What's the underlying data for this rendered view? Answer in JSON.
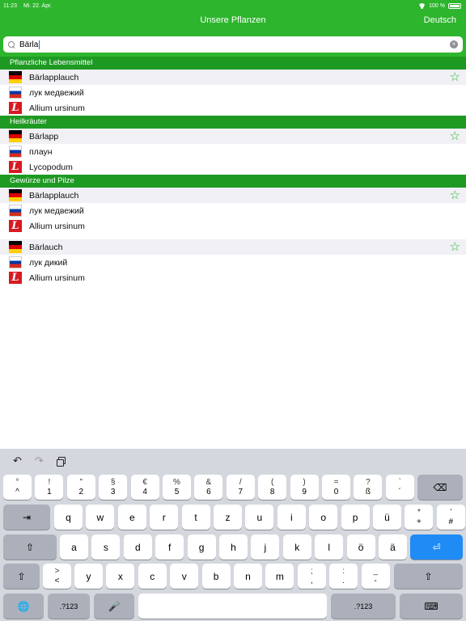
{
  "status": {
    "time": "11:23",
    "date": "Mi. 22. Apr.",
    "battery": "100 %"
  },
  "nav": {
    "title": "Unsere Pflanzen",
    "language_button": "Deutsch"
  },
  "search": {
    "value": "Bärla"
  },
  "sections": [
    {
      "header": "Pflanzliche Lebensmittel",
      "entries": [
        {
          "de": "Bärlapplauch",
          "ru": "лук медвежий",
          "la": "Allium ursinum"
        }
      ]
    },
    {
      "header": "Heilkräuter",
      "entries": [
        {
          "de": "Bärlapp",
          "ru": "плаун",
          "la": "Lycopodum"
        }
      ]
    },
    {
      "header": "Gewürze und Pilze",
      "entries": [
        {
          "de": "Bärlapplauch",
          "ru": "лук медвежий",
          "la": "Allium ursinum"
        },
        {
          "de": "Bärlauch",
          "ru": "лук дикий",
          "la": "Allium ursinum"
        }
      ]
    }
  ],
  "keyboard": {
    "toolbar": {
      "undo": "↶",
      "redo": "↷"
    },
    "row1": [
      {
        "top": "°",
        "bottom": "^"
      },
      {
        "top": "!",
        "bottom": "1"
      },
      {
        "top": "\"",
        "bottom": "2"
      },
      {
        "top": "§",
        "bottom": "3"
      },
      {
        "top": "€",
        "bottom": "4"
      },
      {
        "top": "%",
        "bottom": "5"
      },
      {
        "top": "&",
        "bottom": "6"
      },
      {
        "top": "/",
        "bottom": "7"
      },
      {
        "top": "(",
        "bottom": "8"
      },
      {
        "top": ")",
        "bottom": "9"
      },
      {
        "top": "=",
        "bottom": "0"
      },
      {
        "top": "?",
        "bottom": "ß"
      },
      {
        "top": "`",
        "bottom": "´"
      }
    ],
    "row2": [
      "q",
      "w",
      "e",
      "r",
      "t",
      "z",
      "u",
      "i",
      "o",
      "p",
      "ü"
    ],
    "row2_extra": [
      {
        "top": "*",
        "bottom": "+"
      },
      {
        "top": "'",
        "bottom": "#"
      }
    ],
    "row3": [
      "a",
      "s",
      "d",
      "f",
      "g",
      "h",
      "j",
      "k",
      "l",
      "ö",
      "ä"
    ],
    "row4_first": {
      "top": ">",
      "bottom": "<"
    },
    "row4": [
      "y",
      "x",
      "c",
      "v",
      "b",
      "n",
      "m"
    ],
    "row4_extra": [
      {
        "top": ";",
        "bottom": ","
      },
      {
        "top": ":",
        "bottom": "."
      },
      {
        "top": "_",
        "bottom": "-"
      }
    ],
    "numbers_label": ".?123",
    "icons": {
      "backspace": "⌫",
      "tab": "⇥",
      "shift": "⇧",
      "return": "⏎",
      "globe": "🌐",
      "mic": "🎤",
      "hide": "⌨"
    },
    "colors": {
      "accent": "#2db52d",
      "return_key": "#1f8bf5"
    }
  }
}
